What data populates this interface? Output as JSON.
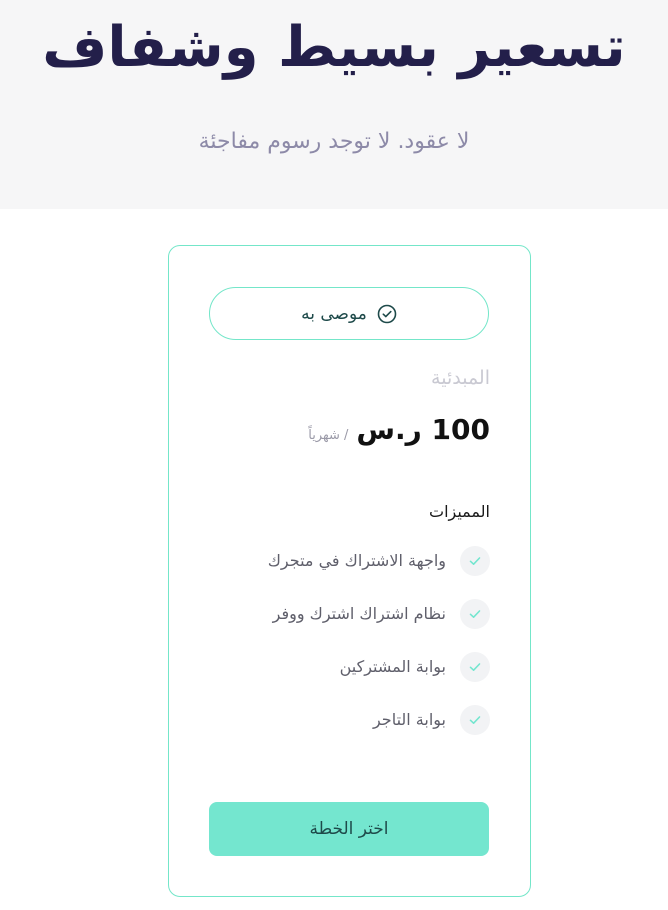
{
  "hero": {
    "title": "تسعير بسيط وشفاف",
    "subtitle": "لا عقود. لا توجد رسوم مفاجئة"
  },
  "plan": {
    "badge_label": "موصى به",
    "badge_icon": "check-circle-icon",
    "name": "المبدئية",
    "price": "100 ر.س",
    "period": "/ شهرياً",
    "features_title": "المميزات",
    "features": [
      {
        "label": "واجهة الاشتراك في متجرك",
        "icon": "check-icon"
      },
      {
        "label": "نظام اشتراك اشترك ووفر",
        "icon": "check-icon"
      },
      {
        "label": "بوابة المشتركين",
        "icon": "check-icon"
      },
      {
        "label": "بوابة التاجر",
        "icon": "check-icon"
      }
    ],
    "cta_label": "اختر الخطة"
  },
  "colors": {
    "accent": "#74e6cf",
    "title": "#231f4a",
    "hero_bg": "#f6f6f7"
  }
}
